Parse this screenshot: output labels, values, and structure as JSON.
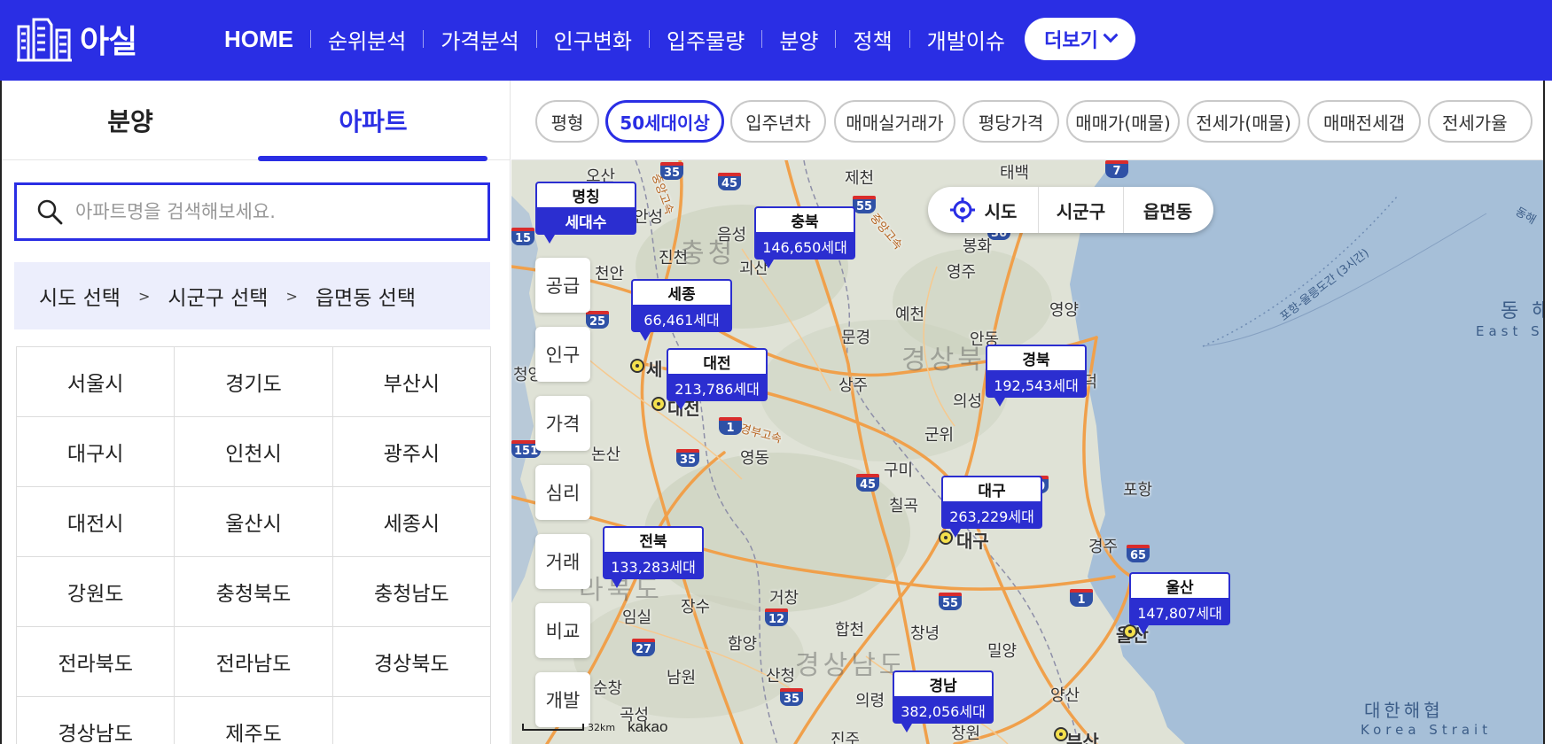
{
  "header": {
    "logo_text": "아실",
    "nav": [
      "HOME",
      "순위분석",
      "가격분석",
      "인구변화",
      "입주물량",
      "분양",
      "정책",
      "개발이슈"
    ],
    "more_label": "더보기"
  },
  "left_panel": {
    "tabs": [
      "분양",
      "아파트"
    ],
    "active_tab": "아파트",
    "search_placeholder": "아파트명을 검색해보세요.",
    "breadcrumb": {
      "sido": "시도 선택",
      "sigungu": "시군구 선택",
      "eupmyeondong": "읍면동 선택",
      "separator": ">"
    },
    "regions": [
      [
        "서울시",
        "경기도",
        "부산시"
      ],
      [
        "대구시",
        "인천시",
        "광주시"
      ],
      [
        "대전시",
        "울산시",
        "세종시"
      ],
      [
        "강원도",
        "충청북도",
        "충청남도"
      ],
      [
        "전라북도",
        "전라남도",
        "경상북도"
      ],
      [
        "경상남도",
        "제주도",
        ""
      ]
    ]
  },
  "filters": {
    "chips": [
      "평형",
      "50세대이상",
      "입주년차",
      "매매실거래가",
      "평당가격",
      "매매가(매물)",
      "전세가(매물)",
      "매매전세갭",
      "전세가율"
    ],
    "active": "50세대이상"
  },
  "map": {
    "legend": {
      "name": "명칭",
      "value": "세대수"
    },
    "levels": [
      "시도",
      "시군구",
      "읍면동"
    ],
    "side_buttons": [
      "공급",
      "인구",
      "가격",
      "심리",
      "거래",
      "비교",
      "개발"
    ],
    "markers": [
      {
        "name": "충북",
        "value": "146,650세대"
      },
      {
        "name": "세종",
        "value": "66,461세대"
      },
      {
        "name": "대전",
        "value": "213,786세대"
      },
      {
        "name": "경북",
        "value": "192,543세대"
      },
      {
        "name": "대구",
        "value": "263,229세대"
      },
      {
        "name": "전북",
        "value": "133,283세대"
      },
      {
        "name": "울산",
        "value": "147,807세대"
      },
      {
        "name": "경남",
        "value": "382,056세대"
      }
    ],
    "place_labels": {
      "osan": "오산",
      "anseong": "안성",
      "jecheon": "제천",
      "taebaek": "태백",
      "eumseong": "음성",
      "jincheon": "진천",
      "goesan": "괴산",
      "bonghwa": "봉화",
      "yeongju": "영주",
      "cheonan": "천안",
      "yecheon": "예천",
      "yeongyang": "영양",
      "mungyeong": "문경",
      "andong": "안동",
      "cheongyang": "청양",
      "sangju": "상주",
      "uiseong": "의성",
      "yeongdeok": "영덕",
      "gunwi": "군위",
      "yeongdong": "영동",
      "nonsan": "논산",
      "gumi": "구미",
      "pohang": "포항",
      "chilgok": "칠곡",
      "gyeongju": "경주",
      "jangsu": "장수",
      "geochang": "거창",
      "hapcheon": "합천",
      "changnyeong": "창녕",
      "miryang": "밀양",
      "imsil": "임실",
      "hamyang": "함양",
      "namwon": "남원",
      "sancheong": "산청",
      "yangsan": "양산",
      "sunchang": "순창",
      "gokseong": "곡성",
      "uiryeong": "의령",
      "jinju": "진주",
      "changwon": "창원",
      "sejong_city": "세",
      "daejeon_city": "대전",
      "daegu_city": "대구",
      "ulsan_city": "울산",
      "busan_city": "부산",
      "region_chungcheong": "충청",
      "region_gyeongbuk": "경상북",
      "region_gyeongnam": "경상남도",
      "region_jeonbuk": "라북도",
      "sea_kr": "대한해협",
      "sea_en": "Korea Strait",
      "east_sea_kr": "동 해",
      "east_sea_en": "East S",
      "east_sea_corner": "동해",
      "boundary": "포항-울릉도간 (3시간)",
      "highway_gyeongbu": "경부고속",
      "highway_jungbu": "중앙고속"
    },
    "route_shields": [
      "35",
      "45",
      "55",
      "36",
      "7",
      "15",
      "25",
      "151",
      "1",
      "35",
      "45",
      "20",
      "65",
      "55",
      "12",
      "27",
      "35",
      "1"
    ],
    "scale_label": "32km",
    "attribution": "kakao",
    "colors": {
      "land": "#dfe2d6",
      "sea": "#a6bfd8",
      "road": "#f0a04b"
    }
  },
  "colors": {
    "brand": "#2a2ee4",
    "marker": "#2b2ed0"
  }
}
